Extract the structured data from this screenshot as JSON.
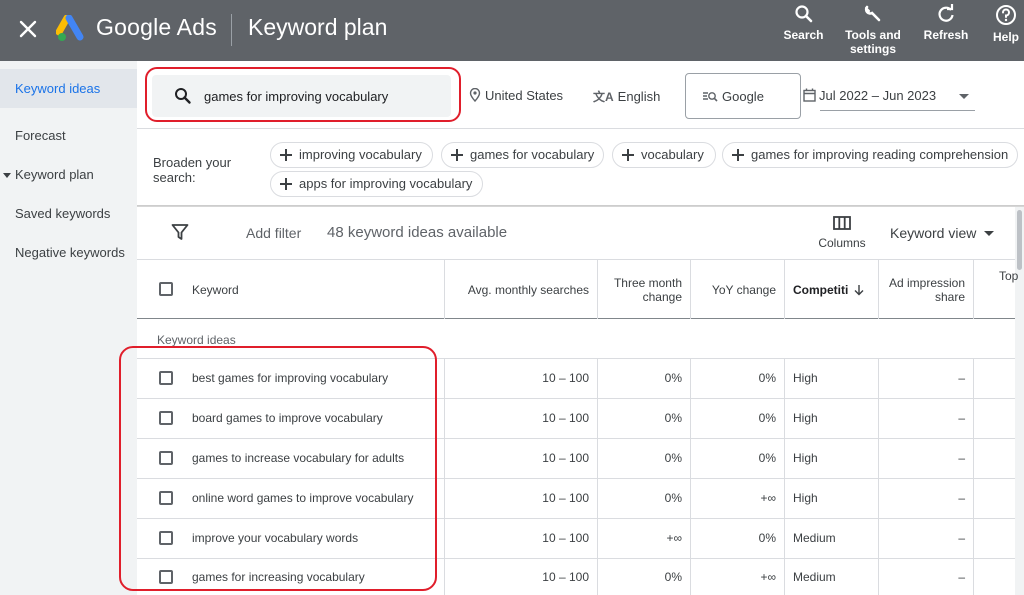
{
  "topbar": {
    "brand": "Google Ads",
    "page_title": "Keyword plan",
    "tools": [
      {
        "label": "Search",
        "icon": "search-icon"
      },
      {
        "label": "Tools and settings",
        "icon": "wrench-icon"
      },
      {
        "label": "Refresh",
        "icon": "refresh-icon"
      },
      {
        "label": "Help",
        "icon": "help-icon"
      }
    ]
  },
  "sidebar": {
    "items": [
      {
        "label": "Keyword ideas",
        "active": true
      },
      {
        "label": "Forecast"
      },
      {
        "label": "Keyword plan"
      },
      {
        "label": "Saved keywords"
      },
      {
        "label": "Negative keywords"
      }
    ]
  },
  "search": {
    "value": "games for improving vocabulary"
  },
  "filters": {
    "location": "United States",
    "language": "English",
    "network": "Google",
    "date_range": "Jul 2022 – Jun 2023"
  },
  "broaden": {
    "label": "Broaden your search:",
    "chips": [
      "improving vocabulary",
      "games for vocabulary",
      "vocabulary",
      "games for improving reading comprehension",
      "apps for improving vocabulary"
    ]
  },
  "toolbar": {
    "add_filter": "Add filter",
    "idea_count": "48 keyword ideas available",
    "columns": "Columns",
    "keyword_view": "Keyword view"
  },
  "table": {
    "headers": {
      "keyword": "Keyword",
      "avg": "Avg. monthly searches",
      "three": "Three month change",
      "yoy": "YoY change",
      "competition": "Competiti",
      "ad_impression": "Ad impression share",
      "top": "Top"
    },
    "group_label": "Keyword ideas",
    "rows": [
      {
        "keyword": "best games for improving vocabulary",
        "avg": "10 – 100",
        "three": "0%",
        "yoy": "0%",
        "competition": "High",
        "ad_impression": "–"
      },
      {
        "keyword": "board games to improve vocabulary",
        "avg": "10 – 100",
        "three": "0%",
        "yoy": "0%",
        "competition": "High",
        "ad_impression": "–"
      },
      {
        "keyword": "games to increase vocabulary for adults",
        "avg": "10 – 100",
        "three": "0%",
        "yoy": "0%",
        "competition": "High",
        "ad_impression": "–"
      },
      {
        "keyword": "online word games to improve vocabulary",
        "avg": "10 – 100",
        "three": "0%",
        "yoy": "+∞",
        "competition": "High",
        "ad_impression": "–"
      },
      {
        "keyword": "improve your vocabulary words",
        "avg": "10 – 100",
        "three": "+∞",
        "yoy": "0%",
        "competition": "Medium",
        "ad_impression": "–"
      },
      {
        "keyword": "games for increasing vocabulary",
        "avg": "10 – 100",
        "three": "0%",
        "yoy": "+∞",
        "competition": "Medium",
        "ad_impression": "–"
      }
    ]
  },
  "colors": {
    "topbar": "#5f6368",
    "accent": "#1a73e8",
    "highlight": "#e01e2b",
    "logo_yellow": "#fbbc04",
    "logo_blue": "#4285f4",
    "logo_green": "#34a853"
  }
}
